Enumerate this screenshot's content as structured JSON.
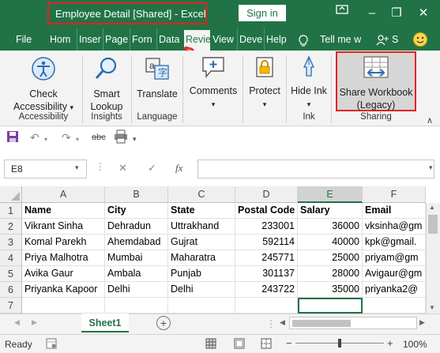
{
  "window": {
    "title": "Employee Detail  [Shared]  -  Excel",
    "sign_in": "Sign in",
    "minimize": "–",
    "restore": "❐",
    "close": "✕"
  },
  "tabs": [
    {
      "label": "File"
    },
    {
      "label": "Hom"
    },
    {
      "label": "Inser"
    },
    {
      "label": "Page"
    },
    {
      "label": "Forn"
    },
    {
      "label": "Data"
    },
    {
      "label": "Revie"
    },
    {
      "label": "View"
    },
    {
      "label": "Deve"
    },
    {
      "label": "Help"
    },
    {
      "label": "Tell me w"
    },
    {
      "label": "S"
    }
  ],
  "ribbon": {
    "check_accessibility": "Check Accessibility",
    "accessibility_group": "Accessibility",
    "smart_lookup": "Smart Lookup",
    "insights_group": "Insights",
    "translate": "Translate",
    "language_group": "Language",
    "comments": "Comments",
    "protect": "Protect",
    "hide_ink": "Hide Ink",
    "ink_group": "Ink",
    "share_workbook": "Share Workbook (Legacy)",
    "sharing_group": "Sharing"
  },
  "formula_bar": {
    "name_box": "E8",
    "fx": "fx",
    "cancel": "✕",
    "enter": "✓"
  },
  "sheet": {
    "columns": [
      "A",
      "B",
      "C",
      "D",
      "E",
      "F"
    ],
    "rows": [
      "1",
      "2",
      "3",
      "4",
      "5",
      "6",
      "7"
    ],
    "headers": [
      "Name",
      "City",
      "State",
      "Postal Code",
      "Salary",
      "Email"
    ],
    "data": [
      [
        "Vikrant Sinha",
        "Dehradun",
        "Uttrakhand",
        "233001",
        "36000",
        "vksinha@gm"
      ],
      [
        "Komal Parekh",
        "Ahemdabad",
        "Gujrat",
        "592114",
        "40000",
        "kpk@gmail."
      ],
      [
        "Priya Malhotra",
        "Mumbai",
        "Maharatra",
        "245771",
        "25000",
        "priyam@gm"
      ],
      [
        "Avika Gaur",
        "Ambala",
        "Punjab",
        "301137",
        "28000",
        "Avigaur@gm"
      ],
      [
        "Priyanka Kapoor",
        "Delhi",
        "Delhi",
        "243722",
        "35000",
        "priyanka2@"
      ]
    ]
  },
  "sheet_tabs": {
    "active": "Sheet1",
    "add": "+"
  },
  "status": {
    "ready": "Ready",
    "zoom": "100%",
    "zoom_minus": "−",
    "zoom_plus": "+"
  },
  "colors": {
    "brand": "#217346",
    "highlight": "#e0241f"
  }
}
